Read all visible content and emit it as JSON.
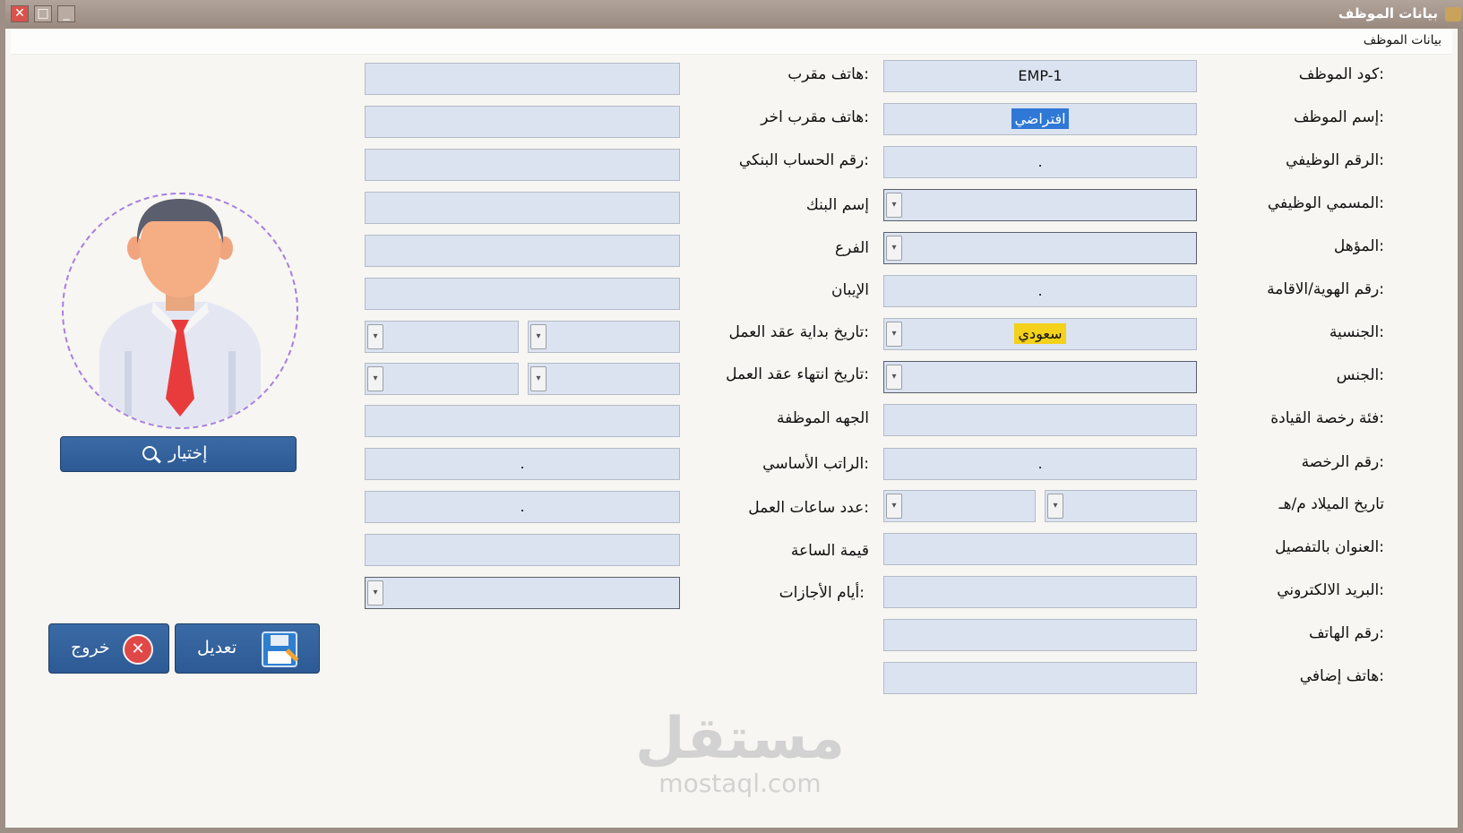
{
  "window": {
    "title": "بيانات الموظف",
    "menu_label": "بيانات الموظف",
    "close_glyph": "✕",
    "max_glyph": "□",
    "min_glyph": "_"
  },
  "right_column": {
    "employee_code": {
      "label": "كود الموظف:",
      "value": "EMP-1"
    },
    "employee_name": {
      "label": "إسم الموظف:",
      "value": "افتراضي"
    },
    "job_number": {
      "label": "الرقم الوظيفي:",
      "value": "."
    },
    "job_title": {
      "label": "المسمي الوظيفي:",
      "value": ""
    },
    "qualification": {
      "label": "المؤهل:",
      "value": ""
    },
    "id_number": {
      "label": "رقم الهوية/الاقامة:",
      "value": "."
    },
    "nationality": {
      "label": "الجنسية:",
      "value": "سعودي"
    },
    "gender": {
      "label": "الجنس:",
      "value": ""
    },
    "license_class": {
      "label": "فئة رخصة القيادة:",
      "value": ""
    },
    "license_number": {
      "label": "رقم الرخصة:",
      "value": "."
    },
    "birth_date": {
      "label": "تاريخ الميلاد م/هـ",
      "gregorian": "",
      "hijri": ""
    },
    "address": {
      "label": "العنوان بالتفصيل:",
      "value": ""
    },
    "email": {
      "label": "البريد الالكتروني:",
      "value": ""
    },
    "phone": {
      "label": "رقم الهاتف:",
      "value": ""
    },
    "extra_phone": {
      "label": "هاتف إضافي:",
      "value": ""
    }
  },
  "middle_column": {
    "relative_phone": {
      "label": "هاتف مقرب:",
      "value": ""
    },
    "relative_phone2": {
      "label": "هاتف مقرب اخر:",
      "value": ""
    },
    "bank_account": {
      "label": "رقم الحساب البنكي:",
      "value": ""
    },
    "bank_name": {
      "label": "إسم البنك",
      "value": ""
    },
    "branch": {
      "label": "الفرع",
      "value": ""
    },
    "iban": {
      "label": "الإيبان",
      "value": ""
    },
    "contract_start": {
      "label": "تاريخ بداية عقد العمل:",
      "gregorian": "",
      "hijri": ""
    },
    "contract_end": {
      "label": "تاريخ انتهاء عقد العمل:",
      "gregorian": "",
      "hijri": ""
    },
    "employer": {
      "label": "الجهه الموظفة",
      "value": ""
    },
    "basic_salary": {
      "label": "الراتب الأساسي:",
      "value": "."
    },
    "work_hours": {
      "label": "عدد ساعات العمل:",
      "value": "."
    },
    "hour_value": {
      "label": "قيمة الساعة",
      "value": ""
    },
    "vacation_days": {
      "label": "أيام الأجازات:",
      "value": ""
    }
  },
  "photo": {
    "choose_button": "إختيار"
  },
  "actions": {
    "edit": "تعديل",
    "exit": "خروج"
  },
  "watermark": {
    "arabic": "مستقل",
    "latin": "mostaql.com"
  },
  "colors": {
    "field_bg": "#dce3f0",
    "button_bg": "#2d5a94",
    "title_bar": "#9d8f86",
    "highlight_blue": "#2f78d6",
    "highlight_yellow": "#f4d11a"
  },
  "icons": [
    "search-icon",
    "save-disk-icon",
    "close-circle-icon",
    "dropdown-arrow-icon",
    "app-icon"
  ]
}
